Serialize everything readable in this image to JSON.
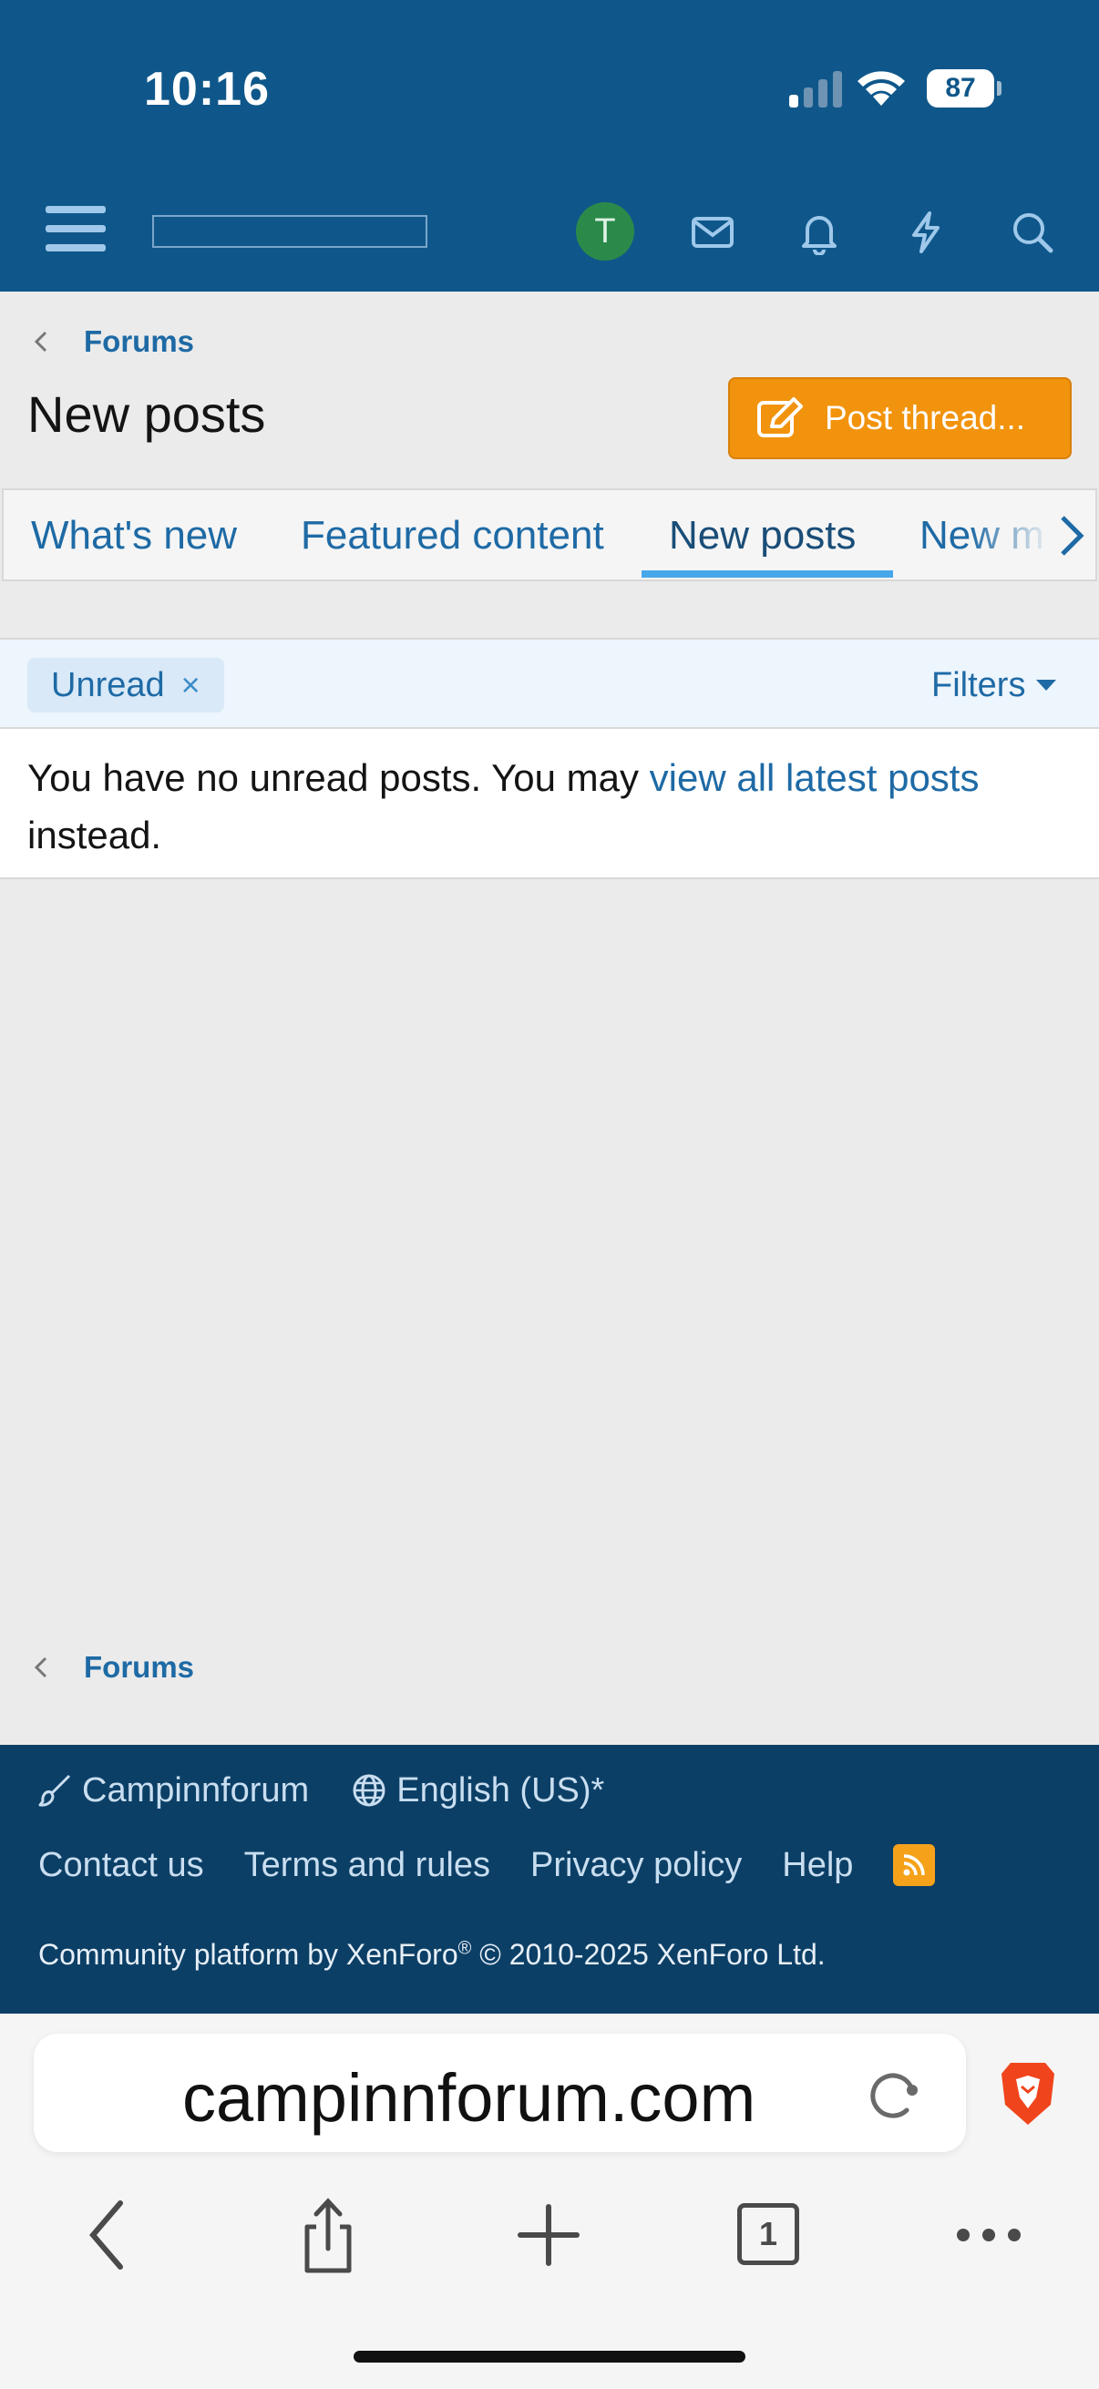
{
  "status_bar": {
    "time": "10:16",
    "battery": "87"
  },
  "nav": {
    "avatar_letter": "T"
  },
  "breadcrumb": {
    "label": "Forums"
  },
  "page": {
    "title": "New posts",
    "post_button_label": "Post thread..."
  },
  "tabs": [
    {
      "label": "What's new"
    },
    {
      "label": "Featured content"
    },
    {
      "label": "New posts",
      "active": true
    },
    {
      "label": "New m"
    }
  ],
  "filter_bar": {
    "chip_label": "Unread",
    "chip_close": "×",
    "filters_label": "Filters"
  },
  "message": {
    "prefix": "You have no unread posts. You may ",
    "link": "view all latest posts",
    "suffix": "instead."
  },
  "footer": {
    "style_label": "Campinnforum",
    "language_label": "English (US)*",
    "links": [
      "Contact us",
      "Terms and rules",
      "Privacy policy",
      "Help"
    ],
    "copyright_prefix": "Community platform by XenForo",
    "copyright_mark": "®",
    "copyright_suffix": " © 2010-2025 XenForo Ltd."
  },
  "browser": {
    "url": "campinnforum.com",
    "tab_count": "1"
  },
  "colors": {
    "header_blue": "#0f578a",
    "link_blue": "#1e6aa5",
    "accent_orange": "#f2930d",
    "footer_blue": "#0c3f66"
  }
}
